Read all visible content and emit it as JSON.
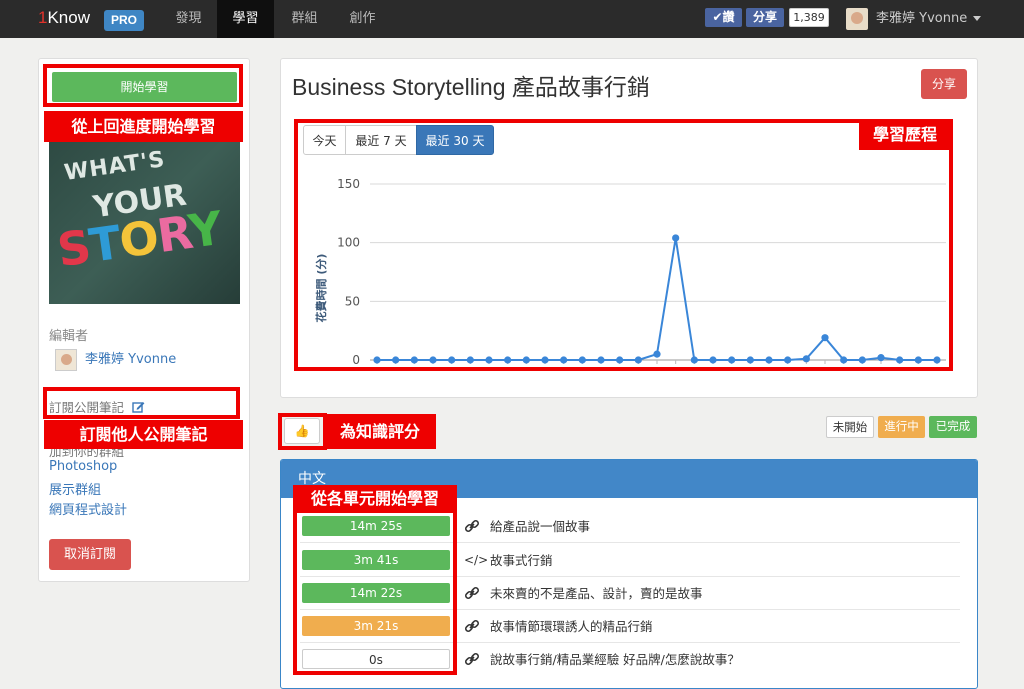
{
  "nav": {
    "brand_one": "1",
    "brand_name": "Know",
    "pro_badge": "PRO",
    "items": [
      {
        "label": "發現"
      },
      {
        "label": "學習"
      },
      {
        "label": "群組"
      },
      {
        "label": "創作"
      }
    ],
    "fb_like": "✔讚",
    "fb_share": "分享",
    "fb_count": "1,389",
    "user_name": "李雅婷 Yvonne"
  },
  "sidebar": {
    "start_button": "開始學習",
    "cover_text": {
      "line1": "WHAT'S",
      "line2": "YOUR",
      "line3": "STORY"
    },
    "editor_label": "編輯者",
    "editor_name": "李雅婷 Yvonne",
    "subscribe_notes": "訂閱公開筆記",
    "join_group": "加到你的群組",
    "groups": [
      "Photoshop",
      "展示群組",
      "網頁程式設計"
    ],
    "unsubscribe_button": "取消訂閱"
  },
  "main": {
    "title": "Business Storytelling 產品故事行銷",
    "share_button": "分享",
    "tabs": [
      {
        "label": "今天"
      },
      {
        "label": "最近 7 天"
      },
      {
        "label": "最近 30 天"
      }
    ]
  },
  "annotations": {
    "start_from_last": "從上回進度開始學習",
    "learning_history": "學習歷程",
    "subscribe_others": "訂閱他人公開筆記",
    "rate_knowledge": "為知識評分",
    "start_from_unit": "從各單元開始學習"
  },
  "rating": {
    "thumb": "👍",
    "legend": [
      {
        "label": "未開始",
        "color": "#ffffff"
      },
      {
        "label": "進行中",
        "color": "#f0ad4e"
      },
      {
        "label": "已完成",
        "color": "#5cb85c"
      }
    ]
  },
  "units": {
    "section_title": "中文",
    "items": [
      {
        "time": "14m 25s",
        "status": "done",
        "icon": "link-icon",
        "title": "給產品說一個故事"
      },
      {
        "time": "3m 41s",
        "status": "done",
        "icon": "code-icon",
        "title": "故事式行銷"
      },
      {
        "time": "14m 22s",
        "status": "done",
        "icon": "link-icon",
        "title": "未來賣的不是產品、設計，賣的是故事"
      },
      {
        "time": "3m 21s",
        "status": "progress",
        "icon": "link-icon",
        "title": "故事情節環環誘人的精品行銷"
      },
      {
        "time": "0s",
        "status": "none",
        "icon": "link-icon",
        "title": "說故事行銷/精品業經驗 好品牌/怎麼說故事？"
      }
    ]
  },
  "chart_data": {
    "type": "line",
    "ylabel": "花費時間 (分)",
    "xlabel": "",
    "ylim": [
      0,
      150
    ],
    "yticks": [
      0,
      50,
      100,
      150
    ],
    "grid": true,
    "color": "#3a86d8",
    "values": [
      0,
      0,
      0,
      0,
      0,
      0,
      0,
      0,
      0,
      0,
      0,
      0,
      0,
      0,
      0,
      5,
      104,
      0,
      0,
      0,
      0,
      0,
      0,
      1,
      19,
      0,
      0,
      2,
      0,
      0,
      0
    ]
  }
}
